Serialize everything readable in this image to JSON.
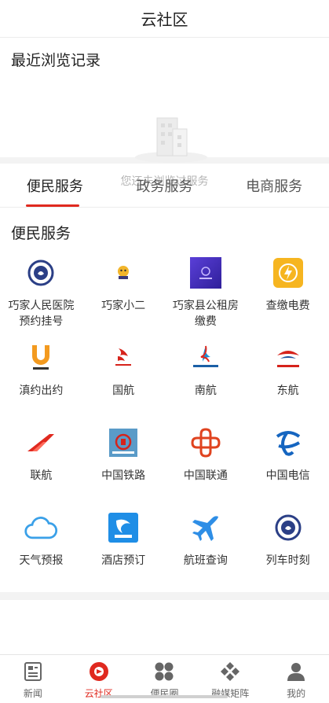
{
  "header": {
    "title": "云社区"
  },
  "recent": {
    "heading": "最近浏览记录",
    "empty_text": "您还未浏览过服务"
  },
  "tabs": [
    {
      "label": "便民服务",
      "active": true
    },
    {
      "label": "政务服务",
      "active": false
    },
    {
      "label": "电商服务",
      "active": false
    }
  ],
  "services": {
    "heading": "便民服务",
    "items": [
      {
        "label": "巧家人民医院预约挂号",
        "icon": "hospital-icon"
      },
      {
        "label": "巧家小二",
        "icon": "qiaojia-xiaoer-icon"
      },
      {
        "label": "巧家县公租房缴费",
        "icon": "public-housing-icon"
      },
      {
        "label": "查缴电费",
        "icon": "electricity-bill-icon"
      },
      {
        "label": "滇约出约",
        "icon": "dianyue-icon"
      },
      {
        "label": "国航",
        "icon": "air-china-icon"
      },
      {
        "label": "南航",
        "icon": "china-southern-icon"
      },
      {
        "label": "东航",
        "icon": "china-eastern-icon"
      },
      {
        "label": "联航",
        "icon": "china-united-icon"
      },
      {
        "label": "中国铁路",
        "icon": "china-railway-icon"
      },
      {
        "label": "中国联通",
        "icon": "china-unicom-icon"
      },
      {
        "label": "中国电信",
        "icon": "china-telecom-icon"
      },
      {
        "label": "天气预报",
        "icon": "weather-icon"
      },
      {
        "label": "酒店预订",
        "icon": "hotel-booking-icon"
      },
      {
        "label": "航班查询",
        "icon": "flight-search-icon"
      },
      {
        "label": "列车时刻",
        "icon": "train-schedule-icon"
      }
    ]
  },
  "bottom_nav": [
    {
      "label": "新闻",
      "icon": "news-icon",
      "active": false
    },
    {
      "label": "云社区",
      "icon": "cloud-community-icon",
      "active": true
    },
    {
      "label": "便民圈",
      "icon": "convenience-circle-icon",
      "active": false
    },
    {
      "label": "融媒矩阵",
      "icon": "media-matrix-icon",
      "active": false
    },
    {
      "label": "我的",
      "icon": "profile-icon",
      "active": false
    }
  ],
  "colors": {
    "accent": "#e0291f"
  }
}
